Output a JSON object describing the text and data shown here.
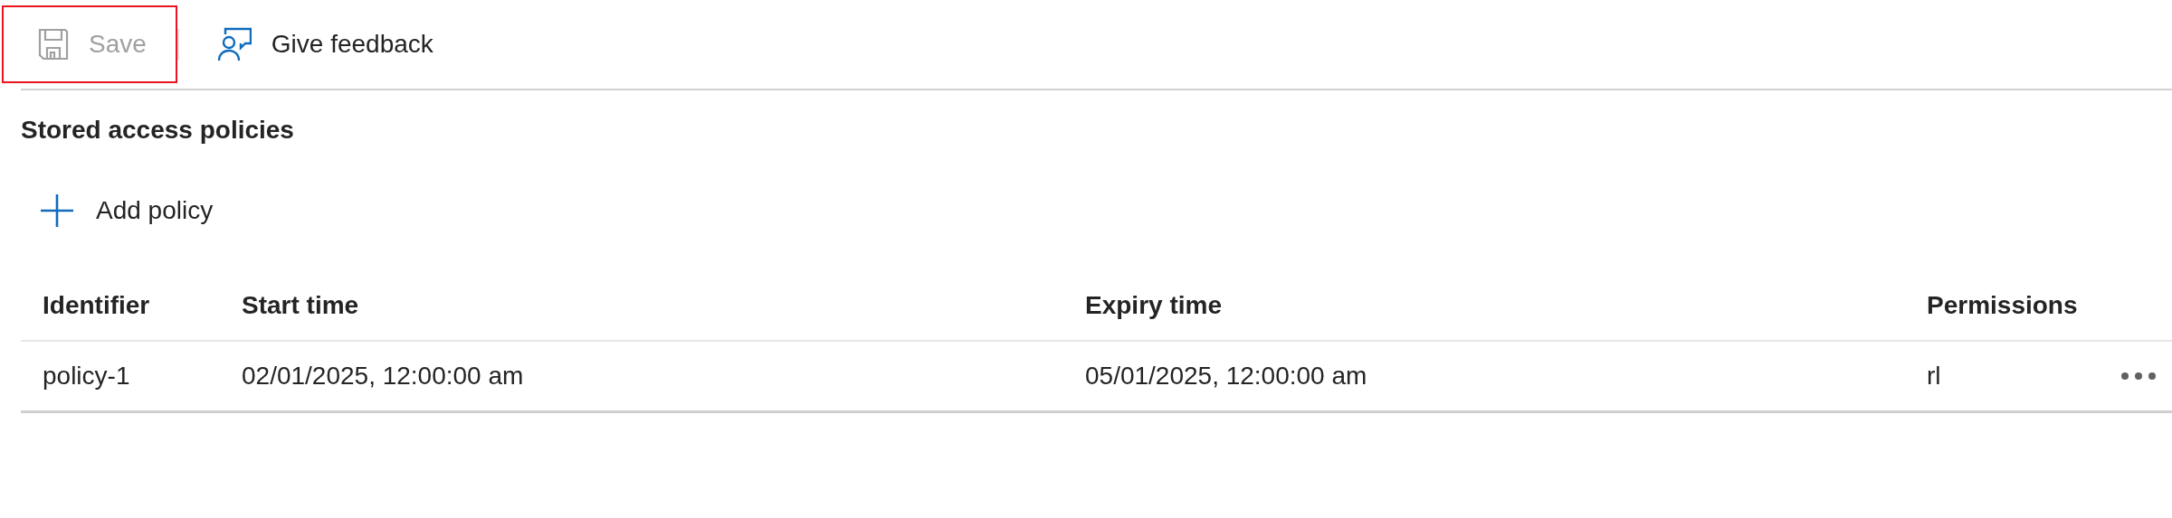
{
  "toolbar": [
    {
      "kind": "save",
      "label": "Save",
      "disabled": true,
      "highlighted": true
    },
    {
      "kind": "feedback",
      "label": "Give feedback",
      "disabled": false,
      "highlighted": false
    }
  ],
  "section_title": "Stored access policies",
  "add_button": {
    "label": "Add policy"
  },
  "table": {
    "columns": [
      "Identifier",
      "Start time",
      "Expiry time",
      "Permissions"
    ],
    "rows": [
      {
        "cells": [
          "policy-1",
          "02/01/2025, 12:00:00 am",
          "05/01/2025, 12:00:00 am",
          "rl"
        ],
        "more_actions": true
      }
    ]
  }
}
